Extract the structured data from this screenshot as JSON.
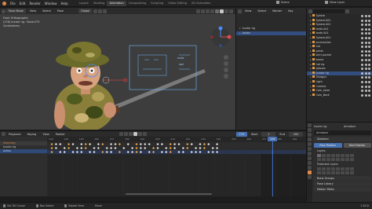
{
  "menu": [
    "File",
    "Edit",
    "Render",
    "Window",
    "Help"
  ],
  "workspaces": [
    {
      "label": "Layout",
      "active": false
    },
    {
      "label": "Shading",
      "active": false
    },
    {
      "label": "Animation",
      "active": true
    },
    {
      "label": "Compositing",
      "active": false
    },
    {
      "label": "Scripting",
      "active": false
    },
    {
      "label": "Video Editing",
      "active": false
    },
    {
      "label": "2D Animation",
      "active": false
    }
  ],
  "scene": {
    "label": "Scene",
    "view_layer": "View Layer"
  },
  "viewport": {
    "mode": "Pose Mode",
    "menus": [
      "View",
      "Select",
      "Pose"
    ],
    "orientation": "Global",
    "overlay_lines": [
      "Front Orthographic",
      "(278) hunter rig : Bone.075",
      "Centimeters"
    ],
    "face_widget_text": [
      "smile",
      "sad"
    ]
  },
  "action_pane": {
    "rows": [
      {
        "label": "hunter rig",
        "selected": false
      },
      {
        "label": "Action",
        "selected": true
      }
    ]
  },
  "outliner": {
    "rows": [
      {
        "label": "Sphere",
        "selected": false
      },
      {
        "label": "Sphere.001",
        "selected": false
      },
      {
        "label": "Sphere.001",
        "selected": false
      },
      {
        "label": "teeth.001",
        "selected": false
      },
      {
        "label": "teeth.001",
        "selected": false
      },
      {
        "label": "Sphere.001",
        "selected": false
      },
      {
        "label": "accessories",
        "selected": false
      },
      {
        "label": "hat",
        "selected": false
      },
      {
        "label": "pants",
        "selected": false
      },
      {
        "label": "shirt pocket",
        "selected": false
      },
      {
        "label": "beard",
        "selected": false
      },
      {
        "label": "hat rig",
        "selected": false
      },
      {
        "label": "glasses",
        "selected": false
      },
      {
        "label": "hunter rig",
        "selected": true
      },
      {
        "label": "Shotgun",
        "selected": false
      },
      {
        "label": "Light",
        "selected": false
      },
      {
        "label": "Camera",
        "selected": false
      },
      {
        "label": "Cam_close",
        "selected": false
      },
      {
        "label": "Cam_Back",
        "selected": false
      }
    ]
  },
  "properties": {
    "object_name": "hunter rig",
    "data_name": "Armature",
    "data_block": "Armature",
    "sections": {
      "skeleton": "Skeleton",
      "pose_position": "Pose Position",
      "rest_position": "Rest Position",
      "layers": "Layers",
      "protected_layers": "Protected Layers",
      "bone_groups": "Bone Groups",
      "pose_library": "Pose Library",
      "motion_paths": "Motion Paths"
    }
  },
  "timeline": {
    "header_items": [
      "Playback",
      "Keying",
      "View",
      "Marker"
    ],
    "current_frame": "278",
    "start": "1",
    "end": "400",
    "start_label": "Start",
    "end_label": "End",
    "ruler": [
      "130",
      "140",
      "150",
      "160",
      "170",
      "180",
      "190",
      "200",
      "210",
      "220",
      "230",
      "240",
      "250",
      "260",
      "270",
      "280",
      "290"
    ],
    "channels": [
      {
        "label": "Summary",
        "color": "#e0884a"
      },
      {
        "label": "hunter rig",
        "color": "#cfcfcf"
      },
      {
        "label": "Action",
        "color": "#8fb6ff"
      }
    ]
  },
  "status_bar": {
    "left": "Set 3D Cursor",
    "middle": "Box Select",
    "middle2": "Rotate View",
    "right": "Move",
    "version": "2.83.8"
  }
}
